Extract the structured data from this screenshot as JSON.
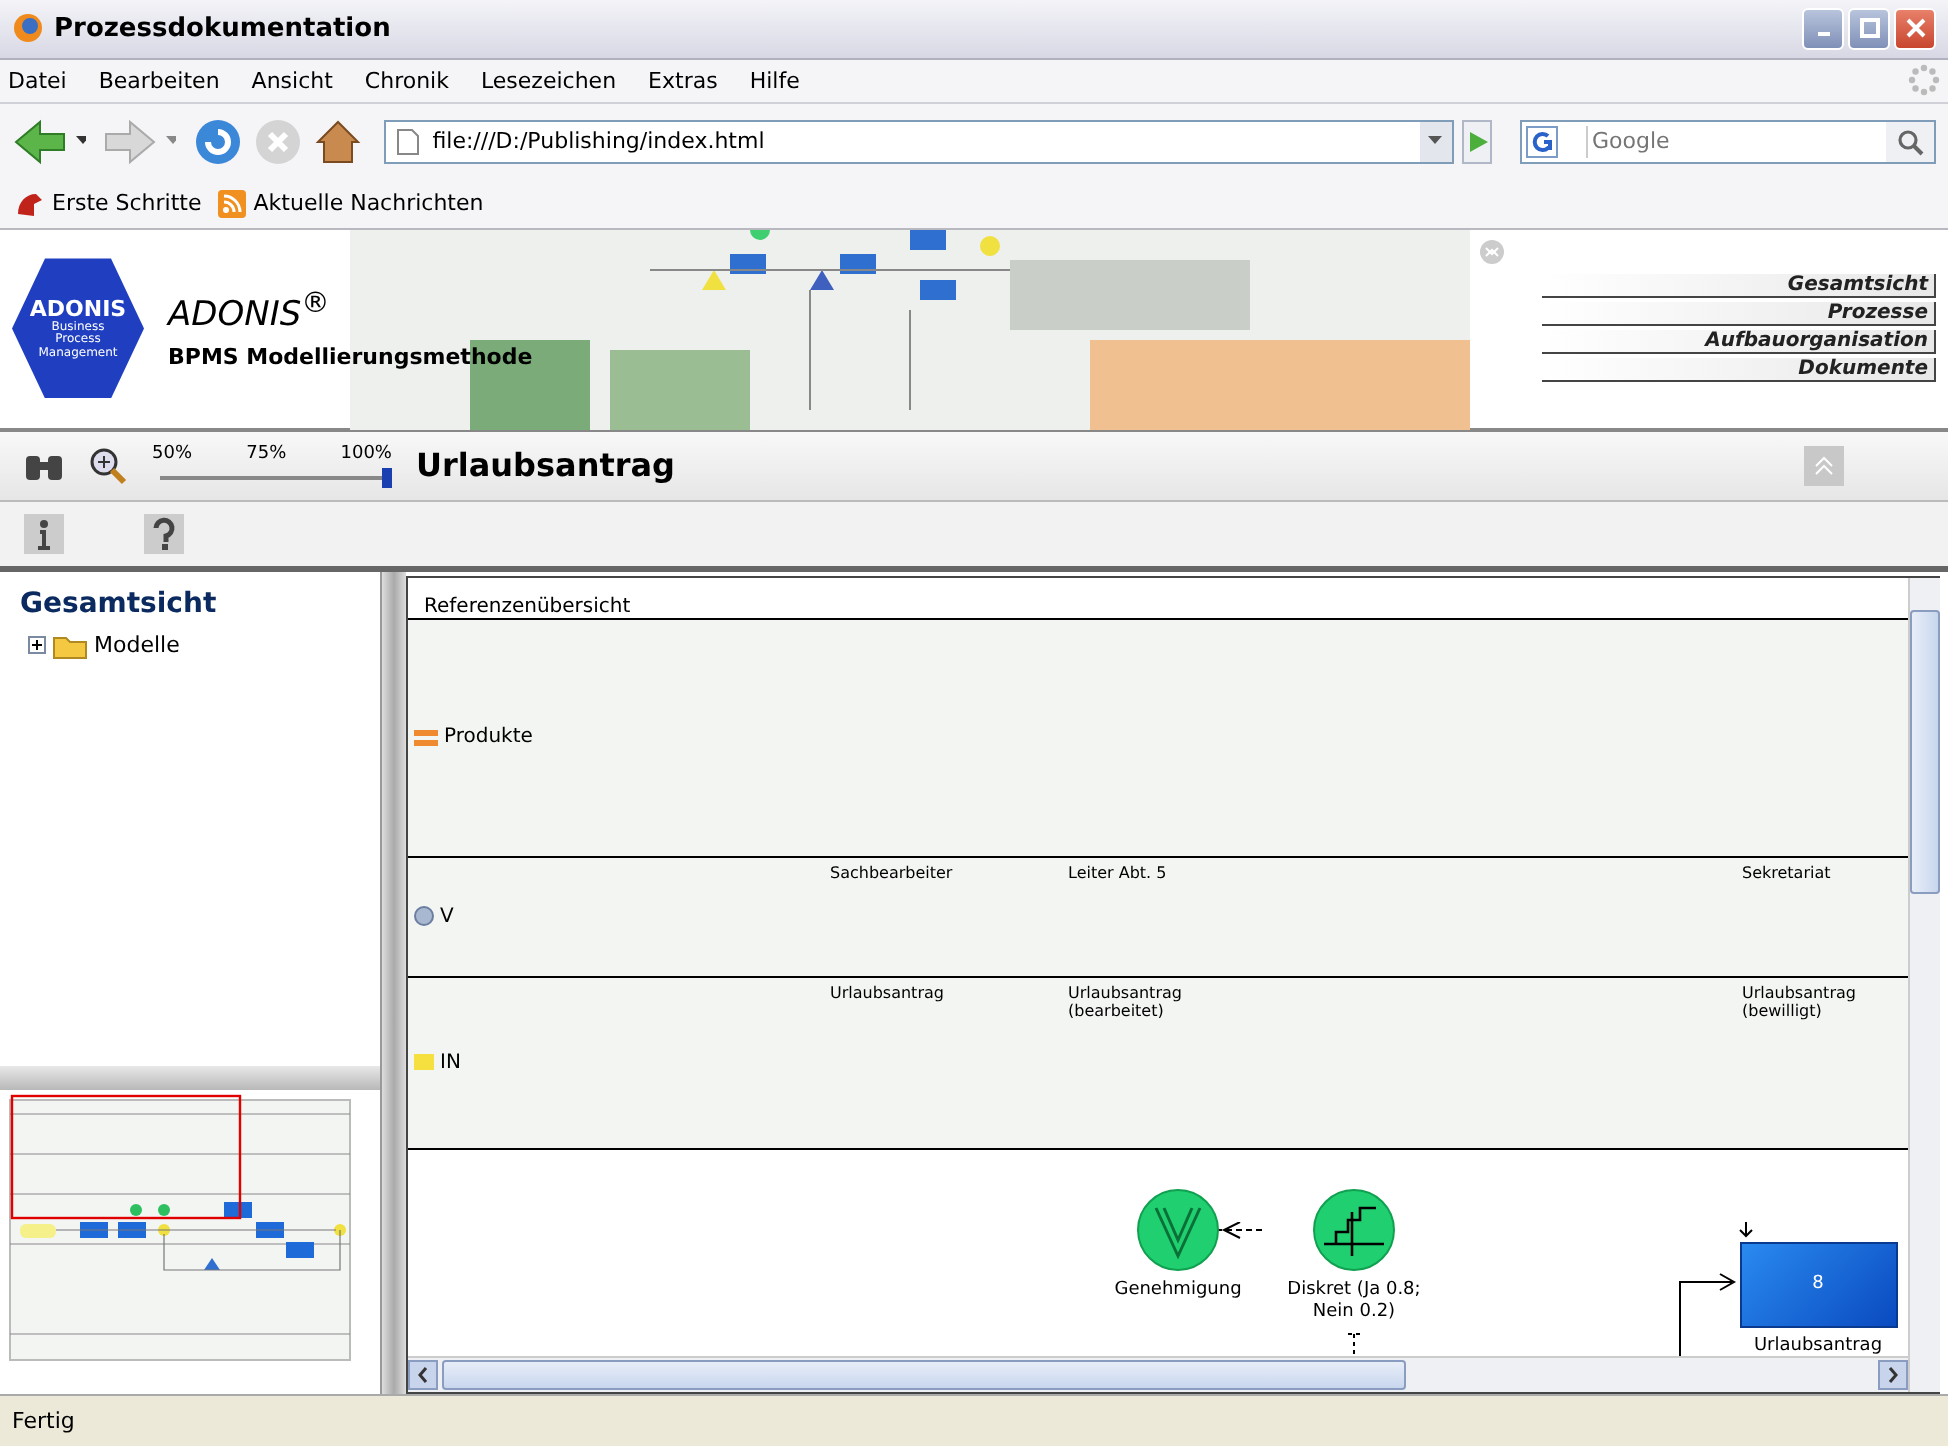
{
  "window": {
    "title": "Prozessdokumentation"
  },
  "menu": [
    "Datei",
    "Bearbeiten",
    "Ansicht",
    "Chronik",
    "Lesezeichen",
    "Extras",
    "Hilfe"
  ],
  "navigation": {
    "address": "file:///D:/Publishing/index.html",
    "search_placeholder": "Google"
  },
  "bookmarks": [
    {
      "kind": "app",
      "label": "Erste Schritte"
    },
    {
      "kind": "feed",
      "label": "Aktuelle Nachrichten"
    }
  ],
  "header": {
    "logo_title": "ADONIS",
    "logo_subtitle": "Business Process Management",
    "product": "ADONIS$^{®}$",
    "subtitle": "BPMS Modellierungsmethode",
    "nav_links": [
      "Gesamtsicht",
      "Prozesse",
      "Aufbauorganisation",
      "Dokumente"
    ]
  },
  "zoom_bar": {
    "zoom_marks": [
      "50%",
      "75%",
      "100%"
    ],
    "zoom": {
      "level": 1.0
    },
    "model_title": "Urlaubsantrag"
  },
  "sidebar": {
    "title": "Gesamtsicht",
    "tree": [
      {
        "label": "Modelle",
        "expanded": false
      }
    ]
  },
  "diagram": {
    "header": "Referenzenübersicht",
    "lanes": [
      {
        "kind": "products",
        "label": "Produkte"
      },
      {
        "kind": "roles",
        "label": "V",
        "columns": [
          {
            "text": "Sachbearbeiter"
          },
          {
            "text": "Leiter Abt. 5"
          },
          {
            "text": "Sekretariat"
          }
        ]
      },
      {
        "kind": "documents",
        "label": "IN",
        "columns": [
          {
            "text": "Urlaubsantrag"
          },
          {
            "text": "Urlaubsantrag (bearbeitet)"
          },
          {
            "text": "Urlaubsantrag (bewilligt)"
          }
        ]
      }
    ],
    "nodes": [
      {
        "kind": "approval",
        "label": "Genehmigung"
      },
      {
        "kind": "distribution",
        "label": "Diskret (Ja 0.8; Nein 0.2)"
      },
      {
        "kind": "activity",
        "number": "8",
        "label": "Urlaubsantrag"
      }
    ]
  },
  "status_bar": "Fertig"
}
